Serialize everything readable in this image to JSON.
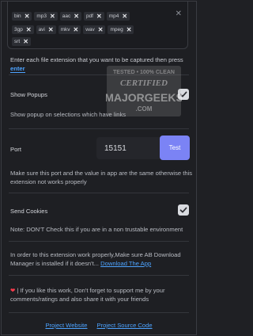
{
  "extensions": {
    "row1": [
      "bin",
      "mp3",
      "aac",
      "pdf",
      "mp4"
    ],
    "row2": [
      "3gp",
      "avi",
      "mkv",
      "wav",
      "mpeg"
    ],
    "row3": [
      "srt"
    ],
    "remove_glyph": "✕",
    "clear_glyph": "✕"
  },
  "extensions_help": "Enter each file extension that you want to be captured then press ",
  "extensions_help_key": "enter",
  "show_popups": {
    "label": "Show Popups",
    "checked": true,
    "description": "Show popup on selections which have links"
  },
  "port": {
    "label": "Port",
    "value": "15151",
    "test_button": "Test",
    "description": "Make sure this port and the value in app are the same otherwise this extension not works properly"
  },
  "send_cookies": {
    "label": "Send Cookies",
    "checked": true,
    "note": "Note: DON'T Check this if you are in a non trustable environment"
  },
  "install_note": {
    "text": "In order to this extension work properly,Make sure AB Download Manager is installed if it doesn't... ",
    "link": "Download The App"
  },
  "support_note": {
    "heart": "❤",
    "text": " | If you like this work, Don't forget to support me by your comments/ratings and also share it with your friends"
  },
  "footer": {
    "project_website": "Project Website",
    "project_source": "Project Source Code"
  },
  "watermark": {
    "line1": "TESTED • 100% CLEAN",
    "line2": "CERTIFIED",
    "line3": "MAJORGEEKS",
    "line4": ".COM"
  },
  "colors": {
    "background": "#1e1f23",
    "accent": "#7b83f5",
    "link": "#4da3ff",
    "heart": "#ff3b4d"
  }
}
